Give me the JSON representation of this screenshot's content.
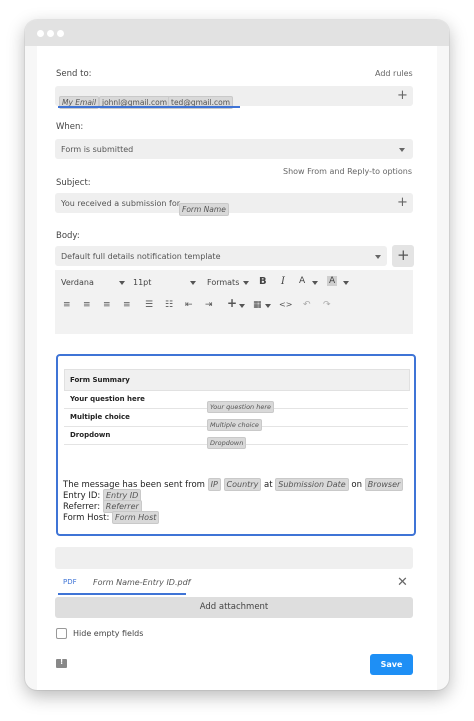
{
  "send_to": {
    "label": "Send to:",
    "add_rules": "Add rules",
    "recipients": [
      "My Email",
      "johnl@gmail.com",
      "ted@gmail.com"
    ]
  },
  "when": {
    "label": "When:",
    "value": "Form is submitted"
  },
  "show_from_link": "Show From and Reply-to options",
  "subject": {
    "label": "Subject:",
    "prefix": "You received a submission for",
    "tag": "Form Name"
  },
  "body": {
    "label": "Body:",
    "template": "Default full details notification template",
    "toolbar": {
      "font": "Verdana",
      "size": "11pt",
      "formats": "Formats",
      "bold": "B",
      "italic": "I",
      "text_color": "A",
      "bg_color": "A"
    }
  },
  "form_summary": {
    "title": "Form Summary",
    "rows": [
      {
        "question": "Your question here",
        "answer": "Your question here"
      },
      {
        "question": "Multiple choice",
        "answer": "Multiple choice"
      },
      {
        "question": "Dropdown",
        "answer": "Dropdown"
      }
    ]
  },
  "message": {
    "line1_prefix": "The message has been sent from",
    "ip": "IP",
    "country": "Country",
    "at": "at",
    "submission_date": "Submission Date",
    "on": "on",
    "browser": "Browser",
    "entry_label": "Entry ID:",
    "entry_tag": "Entry ID",
    "referrer_label": "Referrer:",
    "referrer_tag": "Referrer",
    "host_label": "Form Host:",
    "host_tag": "Form Host"
  },
  "attachment": {
    "badge": "PDF",
    "name": "Form Name-Entry ID.pdf"
  },
  "add_attachment_label": "Add attachment",
  "hide_empty_label": "Hide empty fields",
  "save_label": "Save",
  "colors": {
    "accent": "#3f74d6",
    "save": "#1e8ff5"
  }
}
